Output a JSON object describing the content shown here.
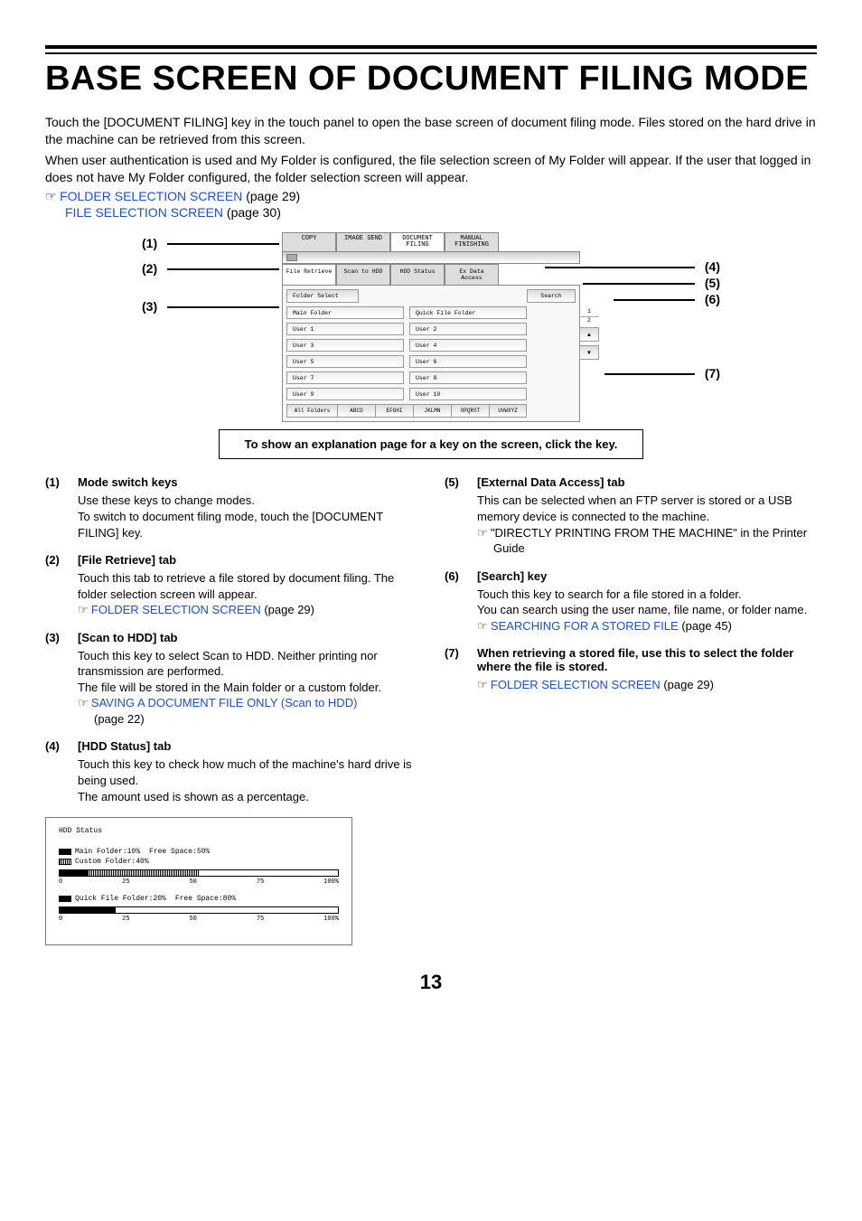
{
  "title": "BASE SCREEN OF DOCUMENT FILING MODE",
  "intro1": "Touch the [DOCUMENT FILING] key in the touch panel to open the base screen of document filing mode. Files stored on the hard drive in the machine can be retrieved from this screen.",
  "intro2": "When user authentication is used and My Folder is configured, the file selection screen of My Folder will appear. If the user that logged in does not have My Folder configured, the folder selection screen will appear.",
  "ref1_link": "FOLDER SELECTION SCREEN",
  "ref1_tail": " (page 29)",
  "ref2_link": "FILE SELECTION SCREEN",
  "ref2_tail": " (page 30)",
  "panel": {
    "top_tabs": [
      "COPY",
      "IMAGE SEND",
      "DOCUMENT FILING",
      "MANUAL FINISHING"
    ],
    "mid_tabs": [
      "File Retrieve",
      "Scan to HDD",
      "HDD Status",
      "Ex Data Access"
    ],
    "folder_select": "Folder Select",
    "search": "Search",
    "folders_left": [
      "Main Folder",
      "User 1",
      "User 3",
      "User 5",
      "User 7",
      "User 9"
    ],
    "folders_right": [
      "Quick File Folder",
      "User 2",
      "User 4",
      "User 6",
      "User 8",
      "User 10"
    ],
    "pager_top": "1",
    "pager_bot": "2",
    "alpha": [
      "All Folders",
      "ABCD",
      "EFGHI",
      "JKLMN",
      "OPQRST",
      "UVWXYZ"
    ]
  },
  "callouts": {
    "c1": "(1)",
    "c2": "(2)",
    "c3": "(3)",
    "c4": "(4)",
    "c5": "(5)",
    "c6": "(6)",
    "c7": "(7)"
  },
  "explain_note": "To show an explanation page for a key on the screen, click the key.",
  "items_left": [
    {
      "num": "(1)",
      "head": "Mode switch keys",
      "body": [
        "Use these keys to change modes.",
        "To switch to document filing mode, touch the [DOCUMENT FILING] key."
      ]
    },
    {
      "num": "(2)",
      "head": "[File Retrieve] tab",
      "body": [
        "Touch this tab to retrieve a file stored by document filing. The folder selection screen will appear."
      ],
      "ref": {
        "link": "FOLDER SELECTION SCREEN",
        "tail": " (page 29)"
      }
    },
    {
      "num": "(3)",
      "head": "[Scan to HDD] tab",
      "body": [
        "Touch this key to select Scan to HDD. Neither printing nor transmission are performed.",
        "The file will be stored in the Main folder or a custom folder."
      ],
      "ref": {
        "link": "SAVING A DOCUMENT FILE ONLY (Scan to HDD)",
        "tail": " (page 22)",
        "below": true
      }
    },
    {
      "num": "(4)",
      "head": "[HDD Status] tab",
      "body": [
        "Touch this key to check how much of the machine's hard drive is being used.",
        "The amount used is shown as a percentage."
      ]
    }
  ],
  "items_right": [
    {
      "num": "(5)",
      "head": "[External Data Access] tab",
      "body": [
        "This can be selected when an FTP server is stored or a USB memory device is connected to the machine."
      ],
      "ref_plain": "\"DIRECTLY PRINTING FROM THE MACHINE\" in the Printer Guide"
    },
    {
      "num": "(6)",
      "head": "[Search] key",
      "body": [
        "Touch this key to search for a file stored in a folder.",
        "You can search using the user name, file name, or folder name."
      ],
      "ref": {
        "link": "SEARCHING FOR A STORED FILE",
        "tail": " (page 45)"
      }
    },
    {
      "num": "(7)",
      "head": "When retrieving a stored file, use this to select the folder where the file is stored.",
      "body": [],
      "ref": {
        "link": "FOLDER SELECTION SCREEN",
        "tail": " (page 29)"
      }
    }
  ],
  "hdd": {
    "title": "HDD Status",
    "main_label": "Main Folder:10%",
    "custom_label": "Custom Folder:40%",
    "free1": "Free Space:50%",
    "quick_label": "Quick File Folder:20%",
    "free2": "Free Space:80%",
    "ticks": [
      "0",
      "25",
      "50",
      "75",
      "100%"
    ]
  },
  "page_number": "13"
}
